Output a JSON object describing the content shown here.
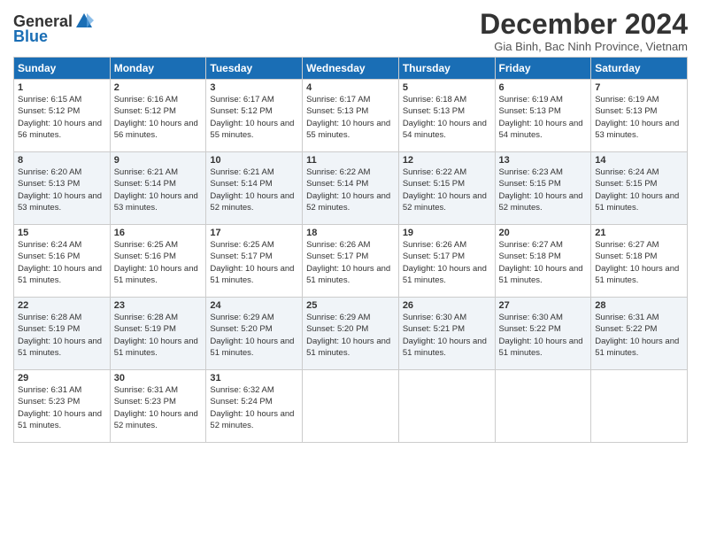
{
  "logo": {
    "general": "General",
    "blue": "Blue"
  },
  "title": "December 2024",
  "subtitle": "Gia Binh, Bac Ninh Province, Vietnam",
  "days_of_week": [
    "Sunday",
    "Monday",
    "Tuesday",
    "Wednesday",
    "Thursday",
    "Friday",
    "Saturday"
  ],
  "weeks": [
    [
      {
        "day": "1",
        "sunrise": "Sunrise: 6:15 AM",
        "sunset": "Sunset: 5:12 PM",
        "daylight": "Daylight: 10 hours and 56 minutes."
      },
      {
        "day": "2",
        "sunrise": "Sunrise: 6:16 AM",
        "sunset": "Sunset: 5:12 PM",
        "daylight": "Daylight: 10 hours and 56 minutes."
      },
      {
        "day": "3",
        "sunrise": "Sunrise: 6:17 AM",
        "sunset": "Sunset: 5:12 PM",
        "daylight": "Daylight: 10 hours and 55 minutes."
      },
      {
        "day": "4",
        "sunrise": "Sunrise: 6:17 AM",
        "sunset": "Sunset: 5:13 PM",
        "daylight": "Daylight: 10 hours and 55 minutes."
      },
      {
        "day": "5",
        "sunrise": "Sunrise: 6:18 AM",
        "sunset": "Sunset: 5:13 PM",
        "daylight": "Daylight: 10 hours and 54 minutes."
      },
      {
        "day": "6",
        "sunrise": "Sunrise: 6:19 AM",
        "sunset": "Sunset: 5:13 PM",
        "daylight": "Daylight: 10 hours and 54 minutes."
      },
      {
        "day": "7",
        "sunrise": "Sunrise: 6:19 AM",
        "sunset": "Sunset: 5:13 PM",
        "daylight": "Daylight: 10 hours and 53 minutes."
      }
    ],
    [
      {
        "day": "8",
        "sunrise": "Sunrise: 6:20 AM",
        "sunset": "Sunset: 5:13 PM",
        "daylight": "Daylight: 10 hours and 53 minutes."
      },
      {
        "day": "9",
        "sunrise": "Sunrise: 6:21 AM",
        "sunset": "Sunset: 5:14 PM",
        "daylight": "Daylight: 10 hours and 53 minutes."
      },
      {
        "day": "10",
        "sunrise": "Sunrise: 6:21 AM",
        "sunset": "Sunset: 5:14 PM",
        "daylight": "Daylight: 10 hours and 52 minutes."
      },
      {
        "day": "11",
        "sunrise": "Sunrise: 6:22 AM",
        "sunset": "Sunset: 5:14 PM",
        "daylight": "Daylight: 10 hours and 52 minutes."
      },
      {
        "day": "12",
        "sunrise": "Sunrise: 6:22 AM",
        "sunset": "Sunset: 5:15 PM",
        "daylight": "Daylight: 10 hours and 52 minutes."
      },
      {
        "day": "13",
        "sunrise": "Sunrise: 6:23 AM",
        "sunset": "Sunset: 5:15 PM",
        "daylight": "Daylight: 10 hours and 52 minutes."
      },
      {
        "day": "14",
        "sunrise": "Sunrise: 6:24 AM",
        "sunset": "Sunset: 5:15 PM",
        "daylight": "Daylight: 10 hours and 51 minutes."
      }
    ],
    [
      {
        "day": "15",
        "sunrise": "Sunrise: 6:24 AM",
        "sunset": "Sunset: 5:16 PM",
        "daylight": "Daylight: 10 hours and 51 minutes."
      },
      {
        "day": "16",
        "sunrise": "Sunrise: 6:25 AM",
        "sunset": "Sunset: 5:16 PM",
        "daylight": "Daylight: 10 hours and 51 minutes."
      },
      {
        "day": "17",
        "sunrise": "Sunrise: 6:25 AM",
        "sunset": "Sunset: 5:17 PM",
        "daylight": "Daylight: 10 hours and 51 minutes."
      },
      {
        "day": "18",
        "sunrise": "Sunrise: 6:26 AM",
        "sunset": "Sunset: 5:17 PM",
        "daylight": "Daylight: 10 hours and 51 minutes."
      },
      {
        "day": "19",
        "sunrise": "Sunrise: 6:26 AM",
        "sunset": "Sunset: 5:17 PM",
        "daylight": "Daylight: 10 hours and 51 minutes."
      },
      {
        "day": "20",
        "sunrise": "Sunrise: 6:27 AM",
        "sunset": "Sunset: 5:18 PM",
        "daylight": "Daylight: 10 hours and 51 minutes."
      },
      {
        "day": "21",
        "sunrise": "Sunrise: 6:27 AM",
        "sunset": "Sunset: 5:18 PM",
        "daylight": "Daylight: 10 hours and 51 minutes."
      }
    ],
    [
      {
        "day": "22",
        "sunrise": "Sunrise: 6:28 AM",
        "sunset": "Sunset: 5:19 PM",
        "daylight": "Daylight: 10 hours and 51 minutes."
      },
      {
        "day": "23",
        "sunrise": "Sunrise: 6:28 AM",
        "sunset": "Sunset: 5:19 PM",
        "daylight": "Daylight: 10 hours and 51 minutes."
      },
      {
        "day": "24",
        "sunrise": "Sunrise: 6:29 AM",
        "sunset": "Sunset: 5:20 PM",
        "daylight": "Daylight: 10 hours and 51 minutes."
      },
      {
        "day": "25",
        "sunrise": "Sunrise: 6:29 AM",
        "sunset": "Sunset: 5:20 PM",
        "daylight": "Daylight: 10 hours and 51 minutes."
      },
      {
        "day": "26",
        "sunrise": "Sunrise: 6:30 AM",
        "sunset": "Sunset: 5:21 PM",
        "daylight": "Daylight: 10 hours and 51 minutes."
      },
      {
        "day": "27",
        "sunrise": "Sunrise: 6:30 AM",
        "sunset": "Sunset: 5:22 PM",
        "daylight": "Daylight: 10 hours and 51 minutes."
      },
      {
        "day": "28",
        "sunrise": "Sunrise: 6:31 AM",
        "sunset": "Sunset: 5:22 PM",
        "daylight": "Daylight: 10 hours and 51 minutes."
      }
    ],
    [
      {
        "day": "29",
        "sunrise": "Sunrise: 6:31 AM",
        "sunset": "Sunset: 5:23 PM",
        "daylight": "Daylight: 10 hours and 51 minutes."
      },
      {
        "day": "30",
        "sunrise": "Sunrise: 6:31 AM",
        "sunset": "Sunset: 5:23 PM",
        "daylight": "Daylight: 10 hours and 52 minutes."
      },
      {
        "day": "31",
        "sunrise": "Sunrise: 6:32 AM",
        "sunset": "Sunset: 5:24 PM",
        "daylight": "Daylight: 10 hours and 52 minutes."
      },
      {
        "day": "",
        "sunrise": "",
        "sunset": "",
        "daylight": ""
      },
      {
        "day": "",
        "sunrise": "",
        "sunset": "",
        "daylight": ""
      },
      {
        "day": "",
        "sunrise": "",
        "sunset": "",
        "daylight": ""
      },
      {
        "day": "",
        "sunrise": "",
        "sunset": "",
        "daylight": ""
      }
    ]
  ]
}
